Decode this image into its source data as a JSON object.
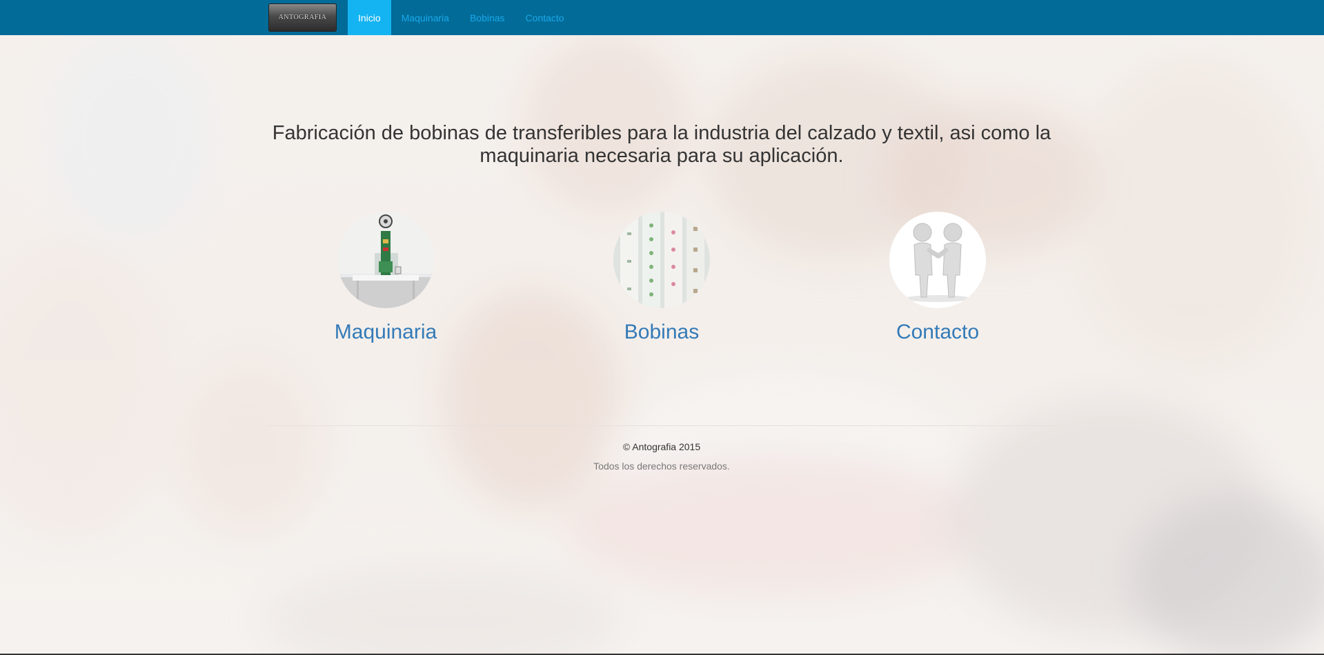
{
  "navbar": {
    "brand_logo_text": "ANTOGRAFIA",
    "items": [
      {
        "label": "Inicio",
        "active": true
      },
      {
        "label": "Maquinaria",
        "active": false
      },
      {
        "label": "Bobinas",
        "active": false
      },
      {
        "label": "Contacto",
        "active": false
      }
    ]
  },
  "main": {
    "lead": "Fabricación de bobinas de transferibles para la industria del calzado y textil, asi como la maquinaria necesaria para su aplicación.",
    "cards": [
      {
        "title": "Maquinaria",
        "image": "machine-photo"
      },
      {
        "title": "Bobinas",
        "image": "transfer-reels-photo"
      },
      {
        "title": "Contacto",
        "image": "handshake-figures"
      }
    ]
  },
  "footer": {
    "copyright": "© Antografia 2015",
    "rights": "Todos los derechos reservados."
  },
  "colors": {
    "navbar_bg": "#026b98",
    "nav_active_bg": "#14b4f2",
    "nav_link": "#19a9ec",
    "card_link": "#337ab7"
  }
}
